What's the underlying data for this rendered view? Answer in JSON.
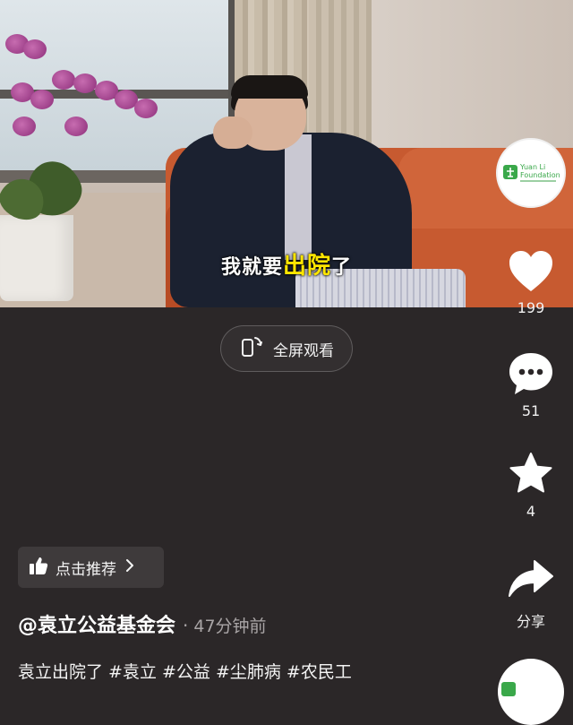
{
  "video": {
    "subtitle_part1": "我就要",
    "subtitle_part2": "出院",
    "subtitle_part3": "了"
  },
  "fullscreen": {
    "label": "全屏观看",
    "icon": "rotate-phone-icon"
  },
  "sidebar": {
    "avatar_logo_line1": "Yuan Li",
    "avatar_logo_line2": "Foundation",
    "like_count": "199",
    "comment_count": "51",
    "favorite_count": "4",
    "share_label": "分享"
  },
  "recommend": {
    "label": "点击推荐",
    "icon": "thumbs-up-icon"
  },
  "post": {
    "author": "@袁立公益基金会",
    "separator": "·",
    "time": "47分钟前",
    "description": "袁立出院了 #袁立 #公益 #尘肺病 #农民工"
  },
  "colors": {
    "background": "#2b2728",
    "subtitle_highlight": "#ffe600",
    "logo_green": "#3aa84a"
  }
}
